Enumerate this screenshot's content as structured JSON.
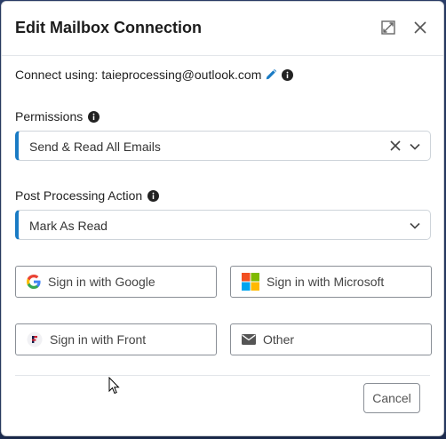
{
  "dialog": {
    "title": "Edit Mailbox Connection",
    "expand_icon": "expand-icon",
    "close_icon": "close-icon"
  },
  "connect": {
    "label": "Connect using:",
    "account": "taieprocessing@outlook.com",
    "edit_icon": "pencil-icon",
    "info_icon": "info-icon"
  },
  "permissions": {
    "label": "Permissions",
    "selected": "Send & Read All Emails"
  },
  "post_processing": {
    "label": "Post Processing Action",
    "selected": "Mark As Read"
  },
  "providers": {
    "google": "Sign in with Google",
    "microsoft": "Sign in with Microsoft",
    "front": "Sign in with Front",
    "other": "Other"
  },
  "footer": {
    "cancel": "Cancel"
  },
  "colors": {
    "accent": "#1a7bc4",
    "pencil": "#1a7bc4"
  }
}
